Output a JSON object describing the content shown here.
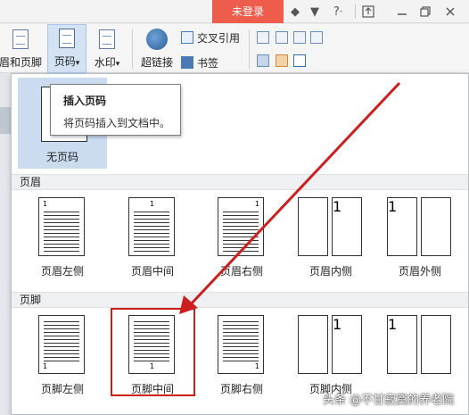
{
  "titlebar": {
    "login_label": "未登录",
    "icons": [
      "skin-icon",
      "shirt-icon",
      "help-icon",
      "minimize-to-top-icon",
      "minimize-icon",
      "restore-icon",
      "close-icon"
    ],
    "help_glyph": "?",
    "help_dropdown_glyph": "-"
  },
  "ribbon": {
    "header_footer_label": "眉和页脚",
    "page_number_label": "页码",
    "page_number_dropdown": "▾",
    "watermark_label": "水印",
    "watermark_dropdown": "▾",
    "hyperlink_label": "超链接",
    "cross_ref_label": "交叉引用",
    "bookmark_label": "书签"
  },
  "tooltip": {
    "title": "插入页码",
    "description": "将页码插入到文档中。"
  },
  "no_page_number": {
    "label": "无页码"
  },
  "header_section": {
    "title": "页眉",
    "items": [
      {
        "label": "页眉左侧",
        "page_number": "1"
      },
      {
        "label": "页眉中间",
        "page_number": "1"
      },
      {
        "label": "页眉右侧",
        "page_number": "1"
      },
      {
        "label": "页眉内侧",
        "page_number": "1"
      },
      {
        "label": "页眉外侧",
        "page_number": "1"
      }
    ]
  },
  "footer_section": {
    "title": "页脚",
    "items": [
      {
        "label": "页脚左侧",
        "page_number": "1"
      },
      {
        "label": "页脚中间",
        "page_number": "1"
      },
      {
        "label": "页脚右侧",
        "page_number": "1"
      },
      {
        "label": "页脚内侧",
        "page_number": "1"
      },
      {
        "label": "",
        "page_number": "1"
      }
    ]
  },
  "watermark_text": "头条 @不甘寂寞的养老院",
  "colors": {
    "login_bg": "#ee5c4c",
    "selected_bg": "#ccdcf0",
    "annotation_red": "#cc2020"
  }
}
